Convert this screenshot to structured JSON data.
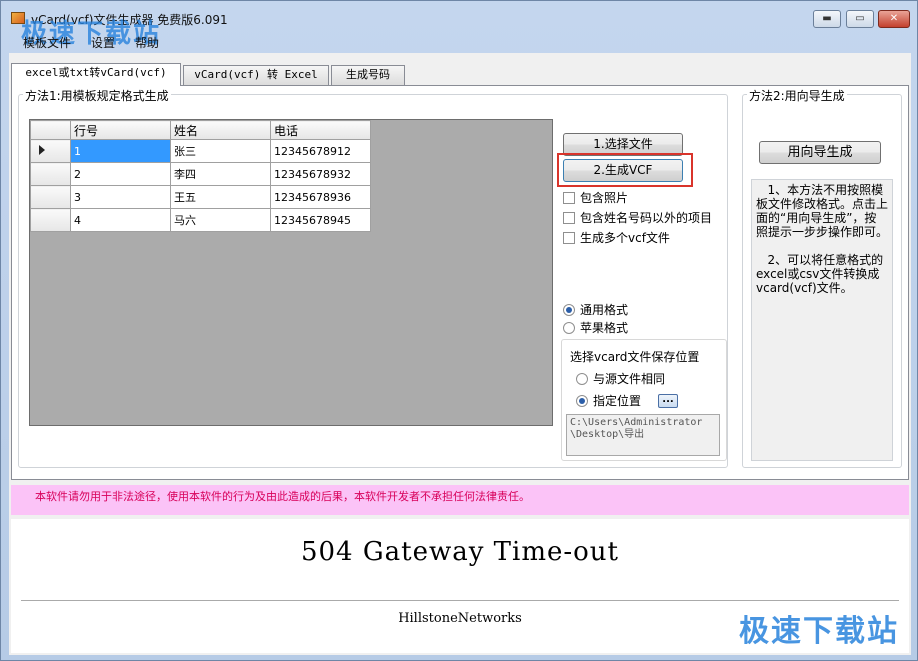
{
  "window": {
    "title": "vCard(vcf)文件生成器 免费版6.091",
    "minimize": "▬",
    "maximize": "▭",
    "close": "✕",
    "watermark": "极速下载站"
  },
  "menu": [
    "模板文件",
    "设置",
    "帮助"
  ],
  "tabs": [
    "excel或txt转vCard(vcf)",
    "vCard(vcf) 转 Excel",
    "生成号码"
  ],
  "method1": {
    "title": "方法1:用模板规定格式生成",
    "grid": {
      "columns": [
        "行号",
        "姓名",
        "电话"
      ],
      "rows": [
        [
          "1",
          "张三",
          "12345678912"
        ],
        [
          "2",
          "李四",
          "12345678932"
        ],
        [
          "3",
          "王五",
          "12345678936"
        ],
        [
          "4",
          "马六",
          "12345678945"
        ]
      ]
    },
    "select_file_button": "1.选择文件",
    "generate_button": "2.生成VCF",
    "checkboxes": [
      "包含照片",
      "包含姓名号码以外的项目",
      "生成多个vcf文件"
    ],
    "format_options": [
      "通用格式",
      "苹果格式"
    ],
    "save_location": {
      "title": "选择vcard文件保存位置",
      "options": [
        "与源文件相同",
        "指定位置"
      ],
      "browse_button": "...",
      "path": "C:\\Users\\Administrator\n\\Desktop\\导出"
    }
  },
  "method2": {
    "title": "方法2:用向导生成",
    "wizard_button": "用向导生成",
    "help": "   1、本方法不用按照模板文件修改格式。点击上面的“用向导生成”，按照提示一步步操作即可。\n\n   2、可以将任意格式的excel或csv文件转换成vcard(vcf)文件。"
  },
  "disclaimer": "本软件请勿用于非法途径，使用本软件的行为及由此造成的后果，本软件开发者不承担任何法律责任。",
  "browser": {
    "error_title": "504 Gateway Time-out",
    "footer": "HillstoneNetworks"
  }
}
